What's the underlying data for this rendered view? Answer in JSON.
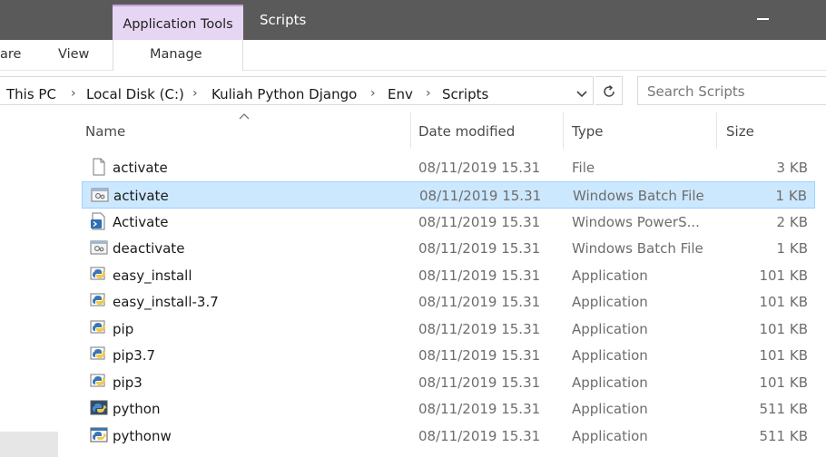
{
  "titlebar": {
    "context_tab": "Application Tools",
    "title": "Scripts"
  },
  "ribbon": {
    "tabs": [
      "are",
      "View",
      "Manage"
    ]
  },
  "address": {
    "crumbs": [
      "This PC",
      "Local Disk (C:)",
      "Kuliah Python Django",
      "Env",
      "Scripts"
    ]
  },
  "search": {
    "placeholder": "Search Scripts"
  },
  "columns": {
    "name": "Name",
    "date": "Date modified",
    "type": "Type",
    "size": "Size"
  },
  "files": [
    {
      "name": "activate",
      "date": "08/11/2019 15.31",
      "type": "File",
      "size": "3 KB",
      "icon": "file-icon"
    },
    {
      "name": "activate",
      "date": "08/11/2019 15.31",
      "type": "Windows Batch File",
      "size": "1 KB",
      "icon": "batch-file-icon",
      "selected": true
    },
    {
      "name": "Activate",
      "date": "08/11/2019 15.31",
      "type": "Windows PowerS...",
      "size": "2 KB",
      "icon": "powershell-file-icon"
    },
    {
      "name": "deactivate",
      "date": "08/11/2019 15.31",
      "type": "Windows Batch File",
      "size": "1 KB",
      "icon": "batch-file-icon"
    },
    {
      "name": "easy_install",
      "date": "08/11/2019 15.31",
      "type": "Application",
      "size": "101 KB",
      "icon": "python-app-icon"
    },
    {
      "name": "easy_install-3.7",
      "date": "08/11/2019 15.31",
      "type": "Application",
      "size": "101 KB",
      "icon": "python-app-icon"
    },
    {
      "name": "pip",
      "date": "08/11/2019 15.31",
      "type": "Application",
      "size": "101 KB",
      "icon": "python-app-icon"
    },
    {
      "name": "pip3.7",
      "date": "08/11/2019 15.31",
      "type": "Application",
      "size": "101 KB",
      "icon": "python-app-icon"
    },
    {
      "name": "pip3",
      "date": "08/11/2019 15.31",
      "type": "Application",
      "size": "101 KB",
      "icon": "python-app-icon"
    },
    {
      "name": "python",
      "date": "08/11/2019 15.31",
      "type": "Application",
      "size": "511 KB",
      "icon": "python-exe-icon"
    },
    {
      "name": "pythonw",
      "date": "08/11/2019 15.31",
      "type": "Application",
      "size": "511 KB",
      "icon": "pythonw-exe-icon"
    }
  ],
  "colors": {
    "titlebar": "#5a5a5a",
    "context_tab": "#e7d6f3",
    "selection": "#cce8ff",
    "selection_border": "#99d1ff"
  }
}
